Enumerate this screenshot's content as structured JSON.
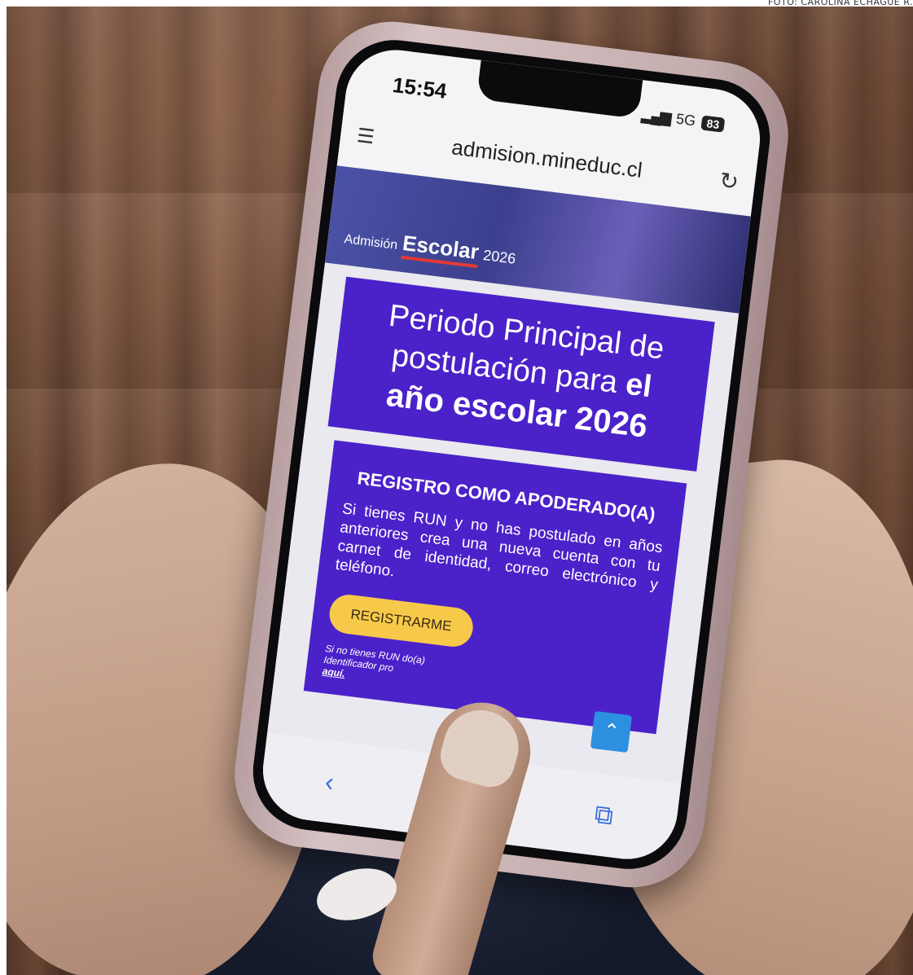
{
  "credit": "FOTO: CAROLINA ECHAGÜE R.",
  "phone": {
    "status": {
      "time": "15:54",
      "network": "5G",
      "battery": "83"
    },
    "browser": {
      "url": "admision.mineduc.cl"
    },
    "site": {
      "logo": {
        "part1": "Admisión",
        "part2": "Escolar",
        "part3": "2026"
      },
      "hero": {
        "line1": "Periodo Principal de",
        "line2a": "postulación para ",
        "line2b": "el",
        "line3": "año escolar 2026"
      },
      "card": {
        "title": "REGISTRO COMO APODERADO(A)",
        "body": "Si tienes RUN y no has postulado en años anteriores crea una nueva cuenta con tu carnet de identidad, correo electrónico y teléfono.",
        "button": "REGISTRARME",
        "note_start": "Si no tienes RUN",
        "note_mid": "Identificador pro",
        "note_link": "aquí.",
        "note_end": "do(a)"
      }
    }
  },
  "colors": {
    "hero_bg": "#4b22c9",
    "button_bg": "#f6c94a",
    "case": "#d7c3c4"
  }
}
